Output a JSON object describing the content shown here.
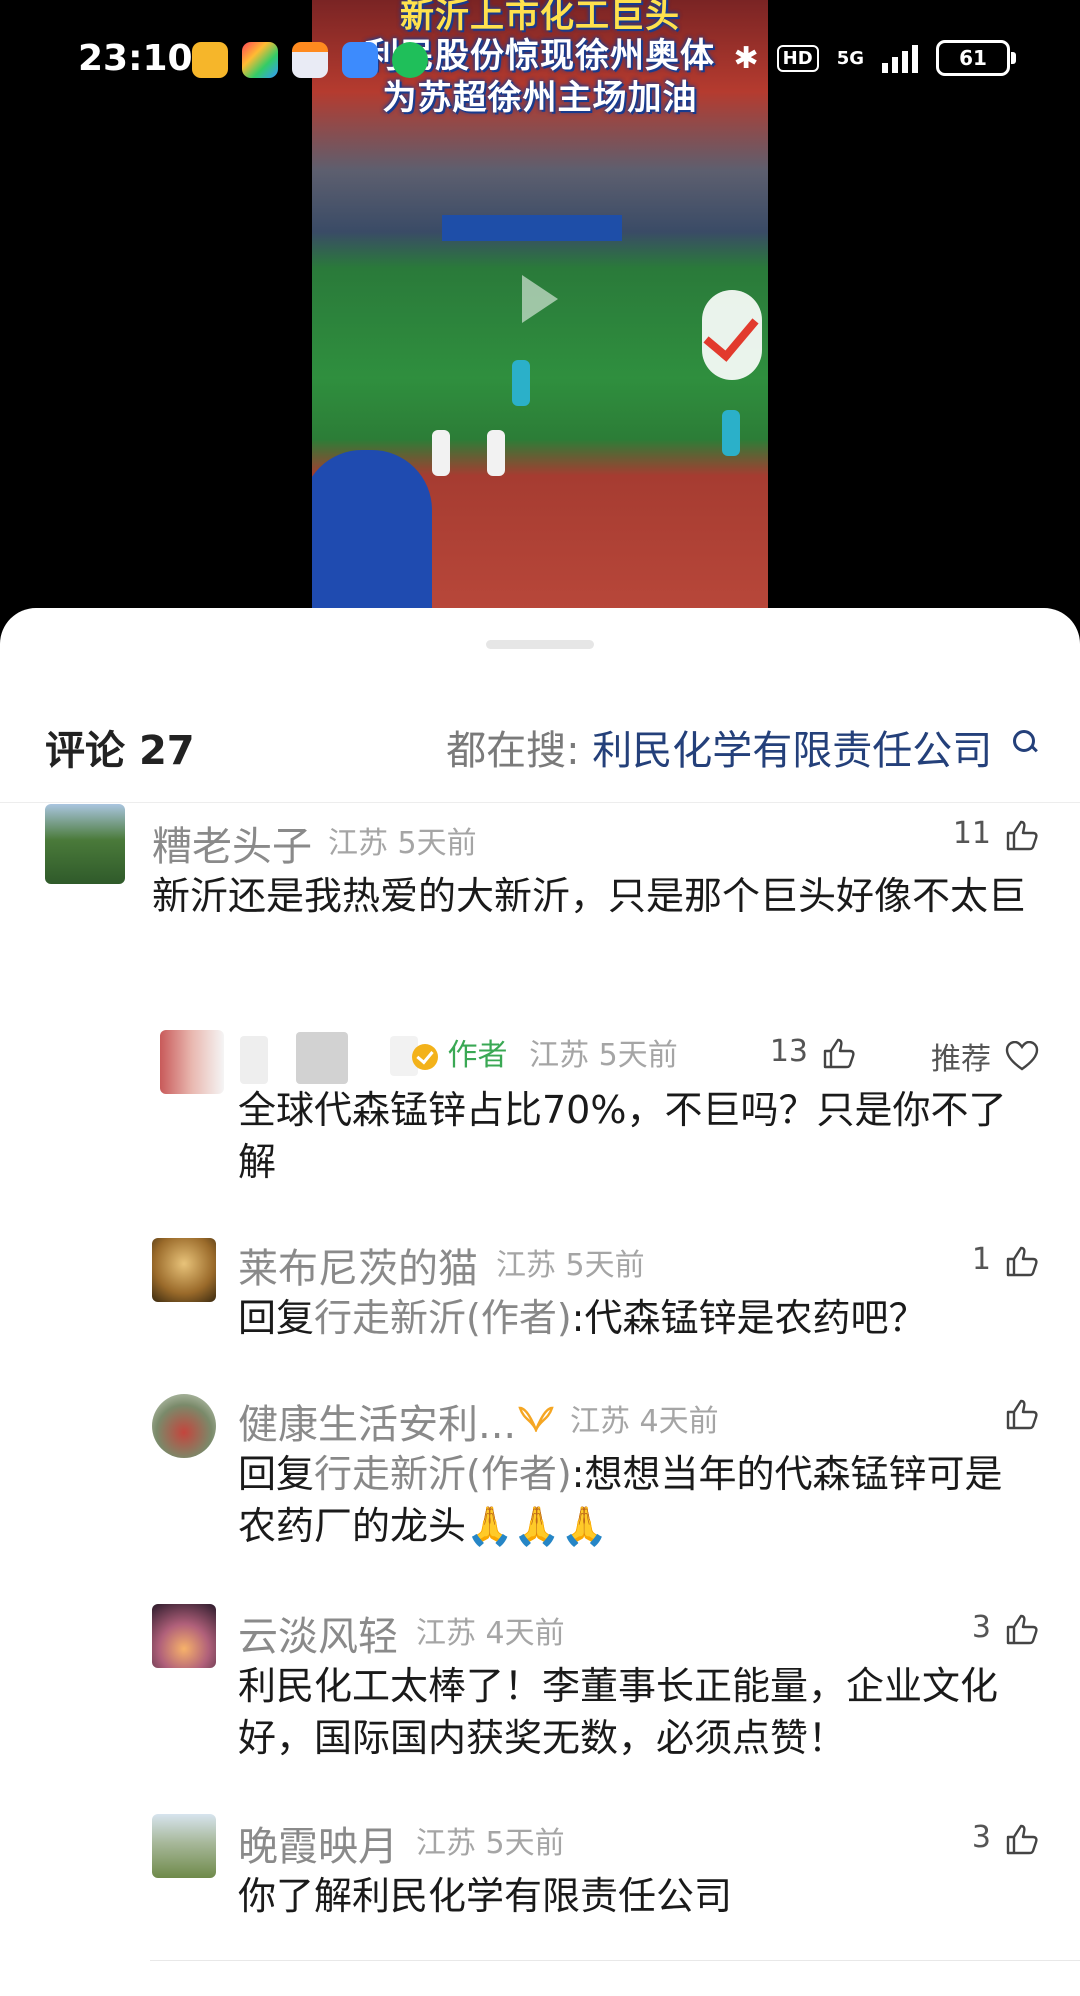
{
  "status_bar": {
    "time": "23:10",
    "hd": "HD",
    "network": "5G",
    "battery": "61"
  },
  "video": {
    "title_line1": "新沂上市化工巨头",
    "title_line2": "利民股份惊现徐州奥体",
    "title_line3": "为苏超徐州主场加油"
  },
  "header": {
    "comments_label": "评论",
    "comments_count": "27",
    "search_prefix": "都在搜:",
    "search_term": "利民化学有限责任公司"
  },
  "comments": [
    {
      "name": "糟老头子",
      "location": "江苏",
      "time": "5天前",
      "likes": "11",
      "text": "新沂还是我热爱的大新沂，只是那个巨头好像不太巨"
    },
    {
      "author_badge": "作者",
      "location": "江苏",
      "time": "5天前",
      "likes": "13",
      "recommend": "推荐",
      "text": "全球代森锰锌占比70%，不巨吗？只是你不了解"
    },
    {
      "name": "莱布尼茨的猫",
      "location": "江苏",
      "time": "5天前",
      "likes": "1",
      "reply_prefix": "回复",
      "reply_to": "行走新沂(作者)",
      "text": ":代森锰锌是农药吧？"
    },
    {
      "name": "健康生活安利...",
      "location": "江苏",
      "time": "4天前",
      "likes": "",
      "reply_prefix": "回复",
      "reply_to": "行走新沂(作者)",
      "text": ":想想当年的代森锰锌可是农药厂的龙头🙏🙏🙏"
    },
    {
      "name": "云淡风轻",
      "location": "江苏",
      "time": "4天前",
      "likes": "3",
      "text": "利民化工太棒了！李董事长正能量，企业文化好，国际国内获奖无数，必须点赞！"
    },
    {
      "name": "晚霞映月",
      "location": "江苏",
      "time": "5天前",
      "likes": "3",
      "text": "你了解利民化学有限责任公司"
    }
  ]
}
